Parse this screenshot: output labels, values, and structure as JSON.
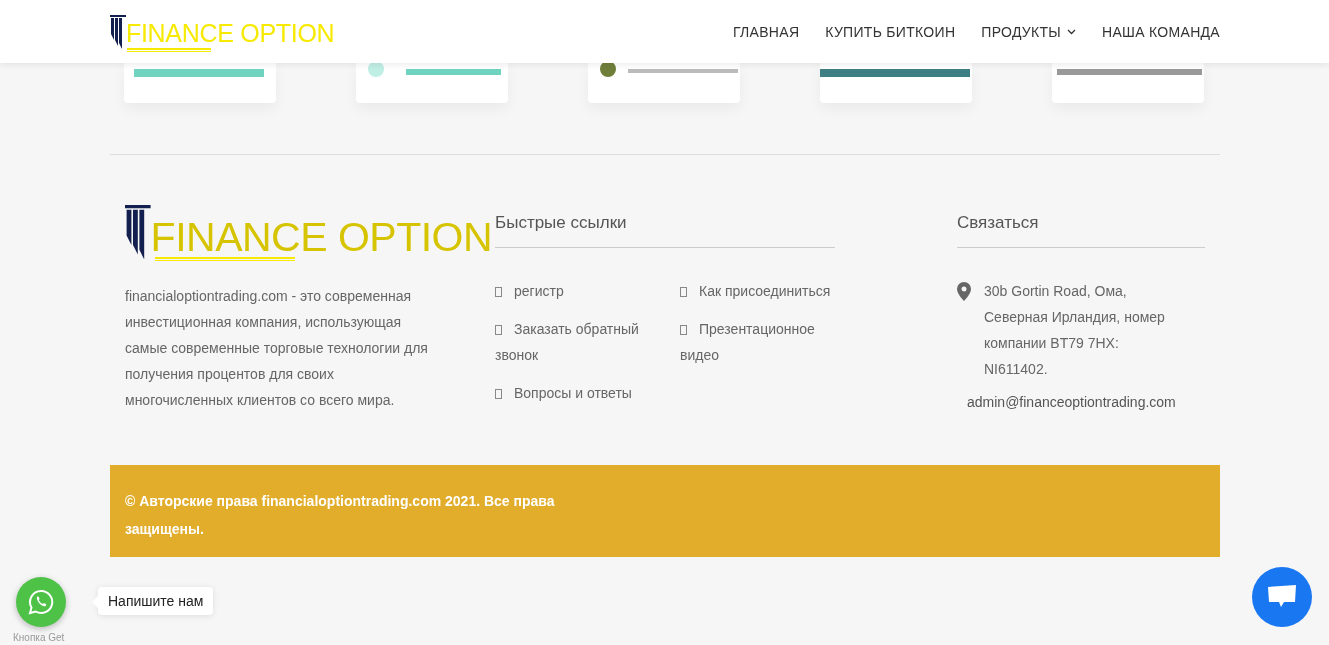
{
  "header": {
    "logo_text": "FINANCE OPTION",
    "nav": [
      {
        "label": "ГЛАВНАЯ",
        "has_dropdown": false
      },
      {
        "label": "КУПИТЬ БИТКОИН",
        "has_dropdown": false
      },
      {
        "label": "ПРОДУКТЫ",
        "has_dropdown": true
      },
      {
        "label": "НАША КОМАНДА",
        "has_dropdown": false
      }
    ]
  },
  "footer": {
    "logo_text": "FINANCE OPTION",
    "about": "financialoptiontrading.com - это современная инвестиционная компания, использующая самые современные торговые технологии для получения процентов для своих многочисленных клиентов со всего мира.",
    "quick_links": {
      "title": "Быстрые ссылки",
      "links": [
        "регистр",
        "Как присоединиться",
        "Заказать обратный звонок",
        "Презентационное видео",
        "Вопросы и ответы"
      ]
    },
    "contact": {
      "title": "Связаться",
      "address": "30b Gortin Road, Ома, Северная Ирландия, номер компании BT79 7HX: NI611402.",
      "email": "admin@financeoptiontrading.com"
    }
  },
  "copyright": "© Авторские права financialoptiontrading.com 2021. Все права защищены.",
  "whatsapp": {
    "tooltip": "Напишите нам",
    "caption": "Кнопка Get"
  }
}
